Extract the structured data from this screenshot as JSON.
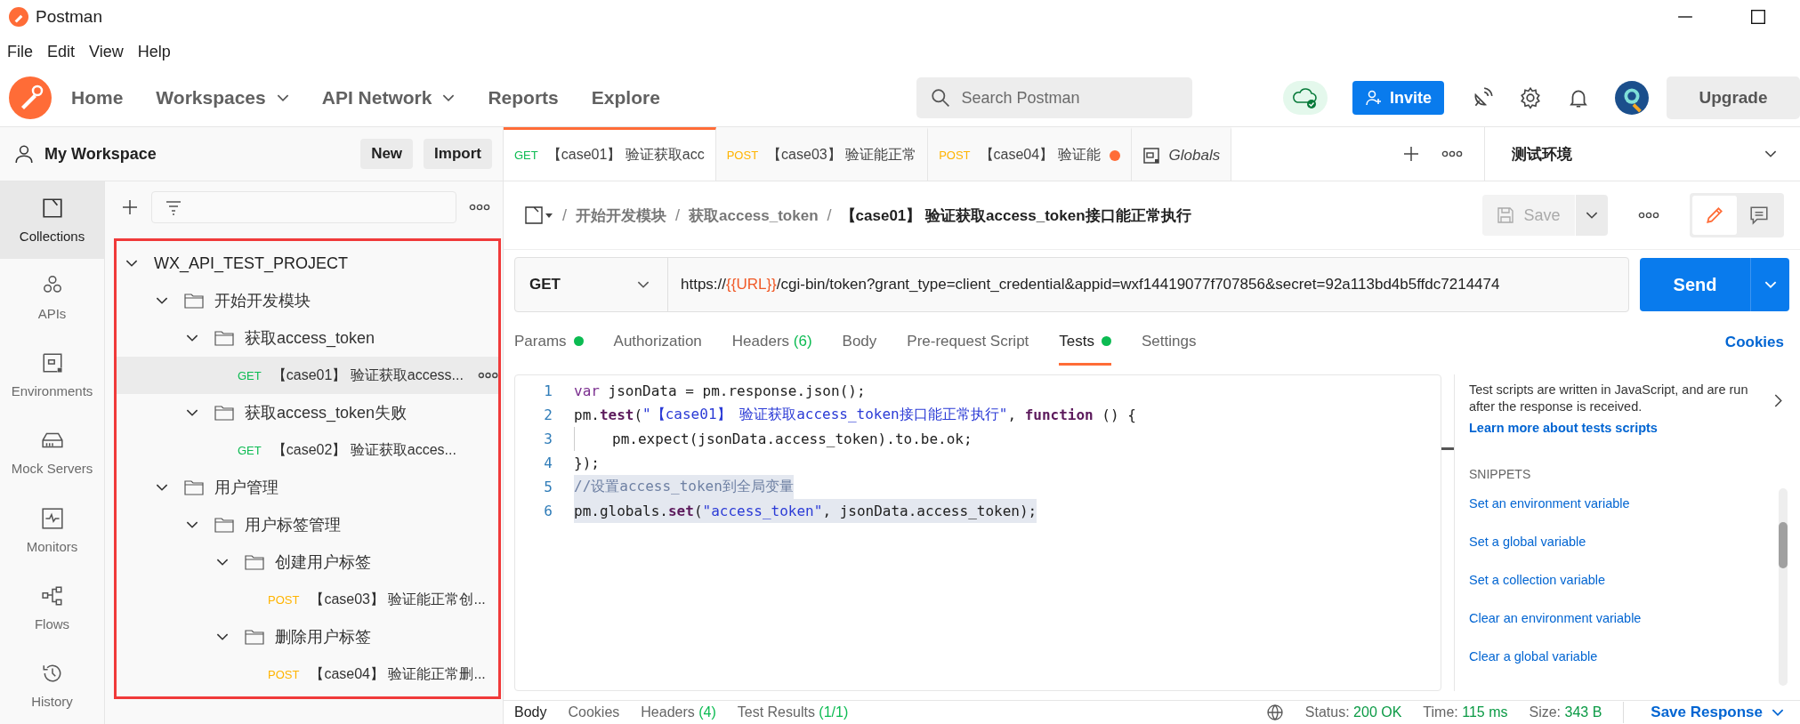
{
  "window": {
    "title": "Postman"
  },
  "menu": [
    "File",
    "Edit",
    "View",
    "Help"
  ],
  "nav": {
    "items": [
      {
        "label": "Home",
        "dropdown": false
      },
      {
        "label": "Workspaces",
        "dropdown": true
      },
      {
        "label": "API Network",
        "dropdown": true
      },
      {
        "label": "Reports",
        "dropdown": false
      },
      {
        "label": "Explore",
        "dropdown": false
      }
    ],
    "search": {
      "placeholder": "Search Postman"
    },
    "invite": "Invite",
    "upgrade": "Upgrade"
  },
  "workspace": {
    "name": "My Workspace",
    "buttons": [
      "New",
      "Import"
    ]
  },
  "rail": [
    {
      "label": "Collections",
      "selected": true
    },
    {
      "label": "APIs",
      "selected": false
    },
    {
      "label": "Environments",
      "selected": false
    },
    {
      "label": "Mock Servers",
      "selected": false
    },
    {
      "label": "Monitors",
      "selected": false
    },
    {
      "label": "Flows",
      "selected": false
    },
    {
      "label": "History",
      "selected": false
    }
  ],
  "tree": {
    "highlighted": true,
    "items": [
      {
        "kind": "collection",
        "label": "WX_API_TEST_PROJECT",
        "expanded": true,
        "children": [
          {
            "kind": "folder",
            "label": "开始开发模块",
            "expanded": true,
            "children": [
              {
                "kind": "folder",
                "label": "获取access_token",
                "expanded": true,
                "children": [
                  {
                    "kind": "request",
                    "method": "GET",
                    "label": "【case01】 验证获取access...",
                    "selected": true
                  }
                ]
              },
              {
                "kind": "folder",
                "label": "获取access_token失败",
                "expanded": true,
                "children": [
                  {
                    "kind": "request",
                    "method": "GET",
                    "label": "【case02】 验证获取acces...",
                    "selected": false
                  }
                ]
              }
            ]
          },
          {
            "kind": "folder",
            "label": "用户管理",
            "expanded": true,
            "children": [
              {
                "kind": "folder",
                "label": "用户标签管理",
                "expanded": true,
                "children": [
                  {
                    "kind": "folder",
                    "label": "创建用户标签",
                    "expanded": true,
                    "children": [
                      {
                        "kind": "request",
                        "method": "POST",
                        "label": "【case03】 验证能正常创...",
                        "selected": false
                      }
                    ]
                  },
                  {
                    "kind": "folder",
                    "label": "删除用户标签",
                    "expanded": true,
                    "children": [
                      {
                        "kind": "request",
                        "method": "POST",
                        "label": "【case04】 验证能正常删...",
                        "selected": false
                      }
                    ]
                  }
                ]
              }
            ]
          }
        ]
      }
    ]
  },
  "tabs": [
    {
      "kind": "request",
      "method": "GET",
      "label": "【case01】 验证获取acc",
      "selected": true,
      "unsaved": false
    },
    {
      "kind": "request",
      "method": "POST",
      "label": "【case03】 验证能正常",
      "selected": false,
      "unsaved": false
    },
    {
      "kind": "request",
      "method": "POST",
      "label": "【case04】 验证能",
      "selected": false,
      "unsaved": true
    },
    {
      "kind": "globals",
      "label": "Globals",
      "selected": false,
      "unsaved": false
    }
  ],
  "environment": "测试环境",
  "breadcrumb": {
    "separator": "/",
    "path": [
      "开始开发模块",
      "获取access_token"
    ],
    "current": "【case01】 验证获取access_token接口能正常执行"
  },
  "save": {
    "label": "Save",
    "disabled": true
  },
  "request": {
    "method": "GET",
    "url_prefix": "https://",
    "url_variable": "{{URL}}",
    "url_rest": "/cgi-bin/token?grant_type=client_credential&appid=wxf14419077f707856&secret=92a113bd4b5ffdc7214474",
    "send": "Send"
  },
  "request_tabs": [
    {
      "label": "Params",
      "dot": true,
      "selected": false
    },
    {
      "label": "Authorization",
      "dot": false,
      "selected": false
    },
    {
      "label": "Headers",
      "count": "(6)",
      "dot": false,
      "selected": false
    },
    {
      "label": "Body",
      "dot": false,
      "selected": false
    },
    {
      "label": "Pre-request Script",
      "dot": false,
      "selected": false
    },
    {
      "label": "Tests",
      "dot": true,
      "selected": true
    },
    {
      "label": "Settings",
      "dot": false,
      "selected": false
    }
  ],
  "cookies_link": "Cookies",
  "code": [
    {
      "number": "1",
      "selected": false,
      "indent": false,
      "tokens": [
        {
          "kind": "kw",
          "text": "var"
        },
        {
          "kind": "plain",
          "text": " jsonData = pm.response.json();"
        }
      ]
    },
    {
      "number": "2",
      "selected": false,
      "indent": false,
      "tokens": [
        {
          "kind": "plain",
          "text": "pm."
        },
        {
          "kind": "fn",
          "text": "test"
        },
        {
          "kind": "plain",
          "text": "("
        },
        {
          "kind": "str",
          "text": "\"【case01】 验证获取access_token接口能正常执行\""
        },
        {
          "kind": "plain",
          "text": ", "
        },
        {
          "kind": "fn",
          "text": "function"
        },
        {
          "kind": "plain",
          "text": " () {"
        }
      ]
    },
    {
      "number": "3",
      "selected": false,
      "indent": true,
      "tokens": [
        {
          "kind": "plain",
          "text": "pm.expect(jsonData.access_token).to.be.ok;"
        }
      ]
    },
    {
      "number": "4",
      "selected": false,
      "indent": false,
      "tokens": [
        {
          "kind": "plain",
          "text": "});"
        }
      ]
    },
    {
      "number": "5",
      "selected": true,
      "indent": false,
      "tokens": [
        {
          "kind": "comment",
          "text": "//设置access_token到全局变量"
        }
      ]
    },
    {
      "number": "6",
      "selected": true,
      "indent": false,
      "tokens": [
        {
          "kind": "plain",
          "text": "pm.globals."
        },
        {
          "kind": "fn",
          "text": "set"
        },
        {
          "kind": "plain",
          "text": "("
        },
        {
          "kind": "str",
          "text": "\"access_token\""
        },
        {
          "kind": "plain",
          "text": ", jsonData.access_token);"
        }
      ]
    }
  ],
  "help": {
    "text": "Test scripts are written in JavaScript, and are run after the response is received.",
    "link": "Learn more about tests scripts",
    "snippets_heading": "SNIPPETS",
    "snippets": [
      "Set an environment variable",
      "Set a global variable",
      "Set a collection variable",
      "Clear an environment variable",
      "Clear a global variable"
    ]
  },
  "response_tabs": [
    {
      "label": "Body",
      "selected": true
    },
    {
      "label": "Cookies",
      "selected": false
    },
    {
      "label": "Headers",
      "count": "(4)",
      "selected": false
    },
    {
      "label": "Test Results",
      "count": "(1/1)",
      "selected": false
    }
  ],
  "response_stats": [
    {
      "label": "Status:",
      "value": "200 OK"
    },
    {
      "label": "Time:",
      "value": "115 ms"
    },
    {
      "label": "Size:",
      "value": "343 B"
    }
  ],
  "save_response": "Save Response"
}
